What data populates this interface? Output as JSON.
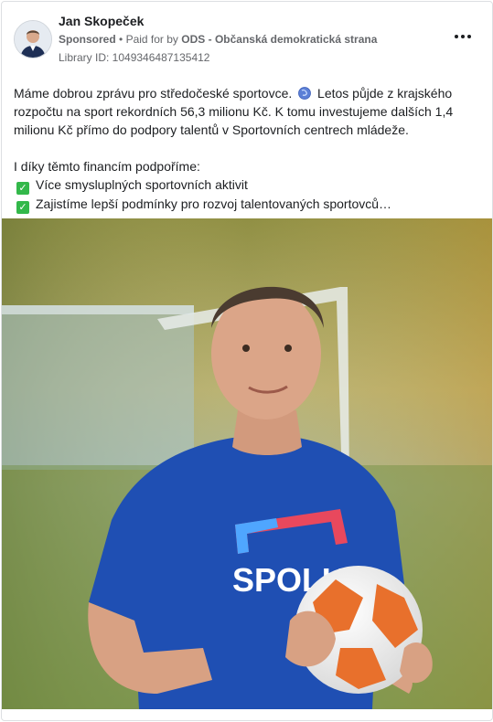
{
  "post": {
    "author": "Jan Skopeček",
    "sponsored_label": "Sponsored",
    "separator": "•",
    "paid_for_prefix": "Paid for by",
    "paid_for_by": "ODS - Občanská demokratická strana",
    "library_id": "Library ID: 1049346487135412",
    "text_line1": "Máme dobrou zprávu pro středočeské sportovce.",
    "text_line1b": "Letos půjde z krajského rozpočtu na sport rekordních 56,3 milionu Kč. K tomu investujeme dalších 1,4 milionu Kč přímo do podpory talentů v Sportovních centrech mládeže.",
    "text_intro": "I díky těmto financím podpoříme:",
    "bullets": [
      "Více smysluplných sportovních aktivit",
      "Zajistíme lepší podmínky pro rozvoj talentovaných sportovců…"
    ],
    "icons": {
      "globe": "soccer-ball-emoji",
      "check": "check-mark-emoji",
      "more": "more-options-icon"
    },
    "image_shirt_text": "SPOLU"
  },
  "colors": {
    "text": "#1c1e21",
    "secondary": "#65676b",
    "check_green": "#33b84a",
    "shirt_blue": "#1f4fb3"
  }
}
